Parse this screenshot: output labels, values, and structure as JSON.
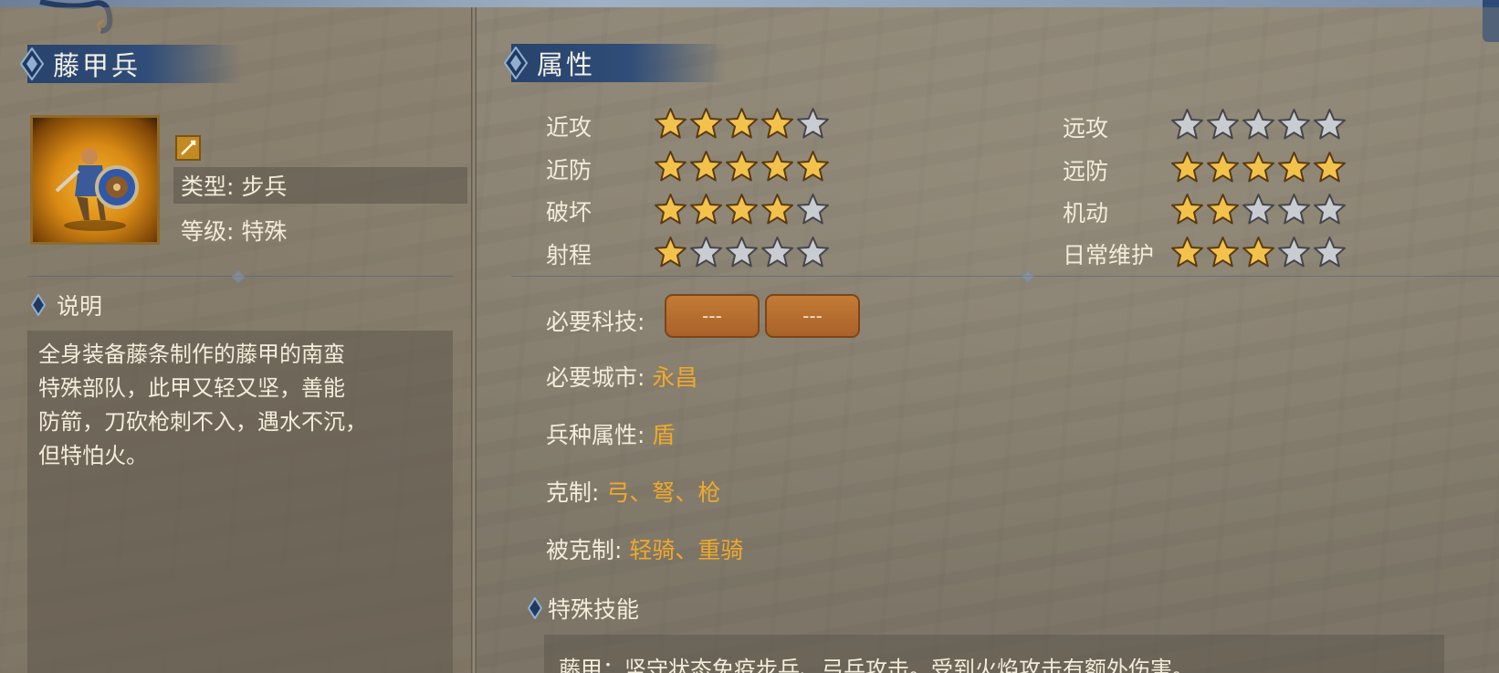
{
  "unit": {
    "name": "藤甲兵",
    "type_text": "类型: 步兵",
    "level_text": "等级: 特殊",
    "portrait_icon": "rattan-armor-soldier-portrait",
    "badge_icon": "sword-badge-icon"
  },
  "description": {
    "heading": "说明",
    "lines": [
      "全身装备藤条制作的藤甲的南蛮",
      "特殊部队，此甲又轻又坚，善能",
      "防箭，刀砍枪刺不入，遇水不沉，",
      "但特怕火。"
    ]
  },
  "attributes": {
    "heading": "属性",
    "left": [
      {
        "label": "近攻",
        "stars": 4
      },
      {
        "label": "近防",
        "stars": 5
      },
      {
        "label": "破坏",
        "stars": 4
      },
      {
        "label": "射程",
        "stars": 1
      }
    ],
    "right": [
      {
        "label": "远攻",
        "stars": 0
      },
      {
        "label": "远防",
        "stars": 5
      },
      {
        "label": "机动",
        "stars": 2
      },
      {
        "label": "日常维护",
        "stars": 3
      }
    ],
    "max_stars": 5
  },
  "requirements": {
    "tech_label": "必要科技:",
    "tech_slots": [
      "---",
      "---"
    ],
    "city_label": "必要城市:",
    "city_value": "永昌",
    "class_label": "兵种属性:",
    "class_value": "盾",
    "counters_label": "克制:",
    "counters_value": "弓、弩、枪",
    "countered_label": "被克制:",
    "countered_value": "轻骑、重骑"
  },
  "skills": {
    "heading": "特殊技能",
    "text": "藤甲：坚守状态免疫步兵、弓兵攻击。受到火焰攻击有额外伤害。"
  },
  "colors": {
    "banner": "#2f4d78",
    "highlight_value": "#f0a92a",
    "star_gold": "#f2c24d",
    "star_silver": "#c9ccd1",
    "tech_button": "#b76c2e"
  }
}
